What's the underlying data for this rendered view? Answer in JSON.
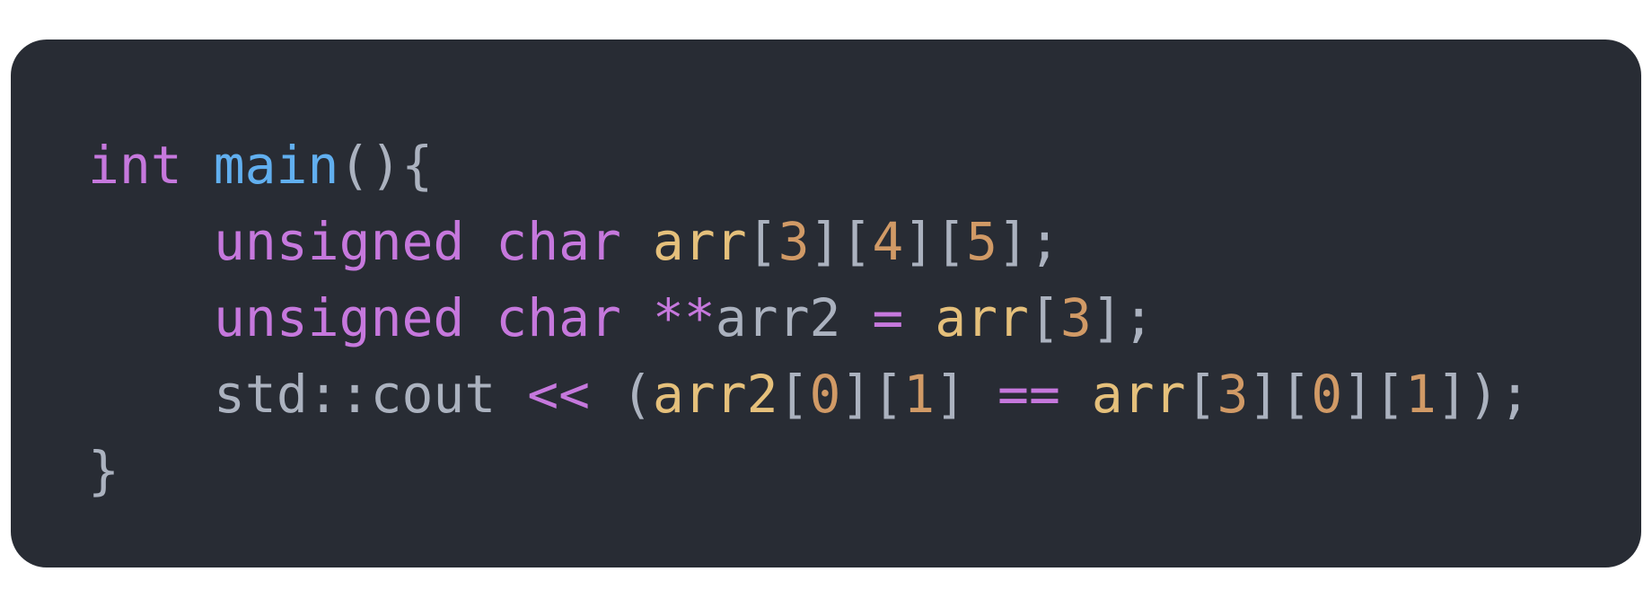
{
  "theme": {
    "background": "#282c34",
    "keyword": "#c678dd",
    "function": "#61afef",
    "punctuation": "#abb2bf",
    "variable": "#e5c07b",
    "number": "#d19a66",
    "operator": "#c678dd"
  },
  "code": {
    "lines": [
      [
        {
          "type": "keyword",
          "text": "int"
        },
        {
          "type": "plain",
          "text": " "
        },
        {
          "type": "func",
          "text": "main"
        },
        {
          "type": "punct",
          "text": "(){"
        }
      ],
      [
        {
          "type": "keyword",
          "text": "unsigned"
        },
        {
          "type": "plain",
          "text": " "
        },
        {
          "type": "keyword",
          "text": "char"
        },
        {
          "type": "plain",
          "text": " "
        },
        {
          "type": "var",
          "text": "arr"
        },
        {
          "type": "punct",
          "text": "["
        },
        {
          "type": "num",
          "text": "3"
        },
        {
          "type": "punct",
          "text": "]["
        },
        {
          "type": "num",
          "text": "4"
        },
        {
          "type": "punct",
          "text": "]["
        },
        {
          "type": "num",
          "text": "5"
        },
        {
          "type": "punct",
          "text": "];"
        }
      ],
      [
        {
          "type": "keyword",
          "text": "unsigned"
        },
        {
          "type": "plain",
          "text": " "
        },
        {
          "type": "keyword",
          "text": "char"
        },
        {
          "type": "plain",
          "text": " "
        },
        {
          "type": "op",
          "text": "**"
        },
        {
          "type": "plain",
          "text": "arr2"
        },
        {
          "type": "plain",
          "text": " "
        },
        {
          "type": "op",
          "text": "="
        },
        {
          "type": "plain",
          "text": " "
        },
        {
          "type": "var",
          "text": "arr"
        },
        {
          "type": "punct",
          "text": "["
        },
        {
          "type": "num",
          "text": "3"
        },
        {
          "type": "punct",
          "text": "];"
        }
      ],
      [
        {
          "type": "plain",
          "text": "std::cout"
        },
        {
          "type": "plain",
          "text": " "
        },
        {
          "type": "op",
          "text": "<<"
        },
        {
          "type": "plain",
          "text": " "
        },
        {
          "type": "punct",
          "text": "("
        },
        {
          "type": "var",
          "text": "arr2"
        },
        {
          "type": "punct",
          "text": "["
        },
        {
          "type": "num",
          "text": "0"
        },
        {
          "type": "punct",
          "text": "]["
        },
        {
          "type": "num",
          "text": "1"
        },
        {
          "type": "punct",
          "text": "]"
        },
        {
          "type": "plain",
          "text": " "
        },
        {
          "type": "op",
          "text": "=="
        },
        {
          "type": "plain",
          "text": " "
        },
        {
          "type": "var",
          "text": "arr"
        },
        {
          "type": "punct",
          "text": "["
        },
        {
          "type": "num",
          "text": "3"
        },
        {
          "type": "punct",
          "text": "]["
        },
        {
          "type": "num",
          "text": "0"
        },
        {
          "type": "punct",
          "text": "]["
        },
        {
          "type": "num",
          "text": "1"
        },
        {
          "type": "punct",
          "text": "]);"
        }
      ],
      [
        {
          "type": "punct",
          "text": "}"
        }
      ]
    ],
    "indented_lines": [
      1,
      2,
      3
    ]
  }
}
